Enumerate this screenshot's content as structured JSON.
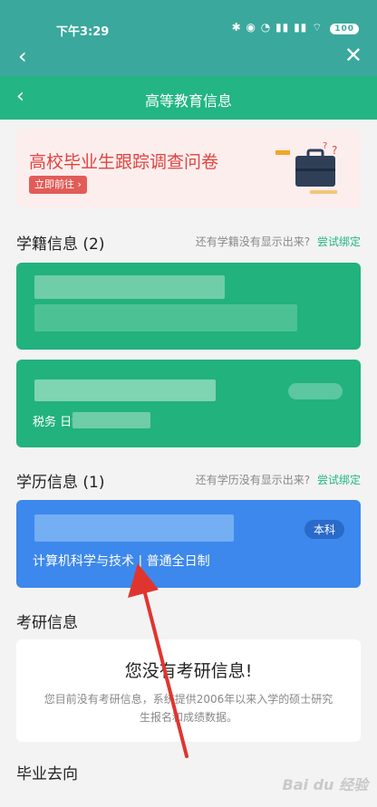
{
  "status_bar": {
    "time": "下午3:29",
    "icons_text": "✱ ◉ ◔ ▮▮ ▮▮ ⌔",
    "battery": "100"
  },
  "browser_bar": {
    "back_icon": "chevron-left-icon",
    "close_icon": "close-icon"
  },
  "app_bar": {
    "title": "高等教育信息"
  },
  "banner": {
    "title": "高校毕业生跟踪调查问卷",
    "cta": "立即前往 ›"
  },
  "school_roll": {
    "title": "学籍信息 (2)",
    "hint": "还有学籍没有显示出来?",
    "link": "尝试绑定",
    "second_card_text": "税务           日制"
  },
  "education": {
    "title": "学历信息 (1)",
    "hint": "还有学历没有显示出来?",
    "link": "尝试绑定",
    "badge": "本科",
    "major_line": "计算机科学与技术 | 普通全日制"
  },
  "postgrad": {
    "title": "考研信息",
    "empty_title": "您没有考研信息!",
    "empty_desc": "您目前没有考研信息，系统提供2006年以来入学的硕士研究生报名和成绩数据。"
  },
  "graduation": {
    "title": "毕业去向"
  },
  "watermark": "Bai du 经验"
}
